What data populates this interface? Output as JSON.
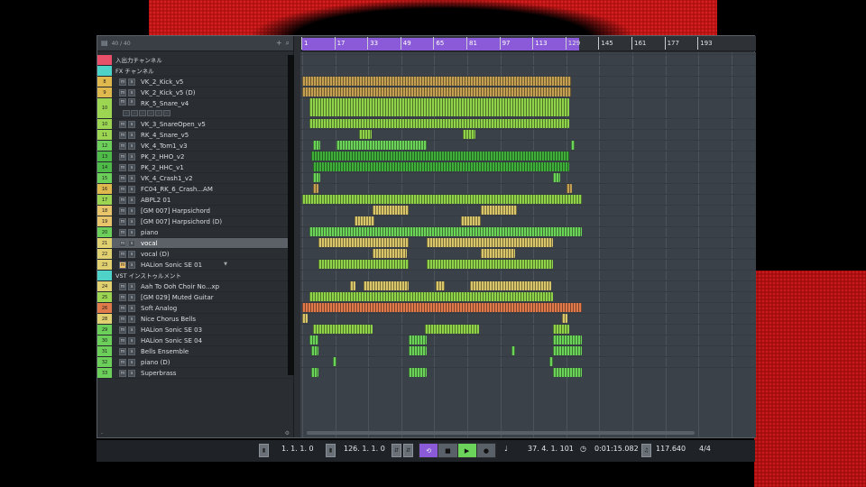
{
  "panel": {
    "count": "40 / 40",
    "add_icon": "plus-icon",
    "search_icon": "search-icon",
    "footer_left": "-",
    "footer_right": "gear-icon"
  },
  "ruler": {
    "ticks": [
      "1",
      "17",
      "33",
      "49",
      "65",
      "81",
      "97",
      "113",
      "129",
      "145",
      "161",
      "177",
      "193"
    ]
  },
  "tracks": [
    {
      "num": "",
      "name": "入出力チャンネル",
      "color": "#e8506a",
      "folder": true
    },
    {
      "num": "",
      "name": "FX チャンネル",
      "color": "#4fd3c8",
      "folder": true
    },
    {
      "num": "8",
      "name": "VK_2_Kick_v5",
      "color": "#e0b94e"
    },
    {
      "num": "9",
      "name": "VK_2_Kick_v5 (D)",
      "color": "#e0b94e"
    },
    {
      "num": "10",
      "name": "RK_5_Snare_v4",
      "color": "#9bd552"
    },
    {
      "num": "10",
      "name": "VK_3_SnareOpen_v5",
      "color": "#9bd552"
    },
    {
      "num": "11",
      "name": "RK_4_Snare_v5",
      "color": "#9bd552"
    },
    {
      "num": "12",
      "name": "VK_4_Tom1_v3",
      "color": "#6bcf5a"
    },
    {
      "num": "13",
      "name": "PK_2_HHO_v2",
      "color": "#4eba48"
    },
    {
      "num": "14",
      "name": "PK_2_HHC_v1",
      "color": "#4eba48"
    },
    {
      "num": "15",
      "name": "VK_4_Crash1_v2",
      "color": "#6bcf5a"
    },
    {
      "num": "16",
      "name": "FC04_RK_6_Crash...AM",
      "color": "#e0b94e"
    },
    {
      "num": "17",
      "name": "ABPL2 01",
      "color": "#9bd552"
    },
    {
      "num": "18",
      "name": "[GM 007] Harpsichord",
      "color": "#e8c56a"
    },
    {
      "num": "19",
      "name": "[GM 007] Harpsichord (D)",
      "color": "#e8c56a"
    },
    {
      "num": "20",
      "name": "piano",
      "color": "#6bcf5a"
    },
    {
      "num": "21",
      "name": "vocal",
      "color": "#e0d070"
    },
    {
      "num": "22",
      "name": "vocal (D)",
      "color": "#e0d070"
    },
    {
      "num": "23",
      "name": "HALion Sonic SE 01",
      "color": "#e0d070"
    },
    {
      "num": "",
      "name": "VST インストゥルメント",
      "color": "#4fd3c8",
      "folder": true
    },
    {
      "num": "24",
      "name": "Aah To Ooh Choir No...xp",
      "color": "#e0d070"
    },
    {
      "num": "25",
      "name": "[GM 029] Muted Guitar",
      "color": "#9bd552"
    },
    {
      "num": "26",
      "name": "Soft Analog",
      "color": "#e07a4a"
    },
    {
      "num": "28",
      "name": "Nice Chorus Bells",
      "color": "#e0d070"
    },
    {
      "num": "29",
      "name": "HALion Sonic SE 03",
      "color": "#6bcf5a"
    },
    {
      "num": "30",
      "name": "HALion Sonic SE 04",
      "color": "#6bcf5a"
    },
    {
      "num": "31",
      "name": "Bells Ensemble",
      "color": "#6bcf5a"
    },
    {
      "num": "32",
      "name": "piano (D)",
      "color": "#6bcf5a"
    },
    {
      "num": "33",
      "name": "Superbrass",
      "color": "#6bcf5a"
    }
  ],
  "transport": {
    "left_locator": "1. 1. 1.   0",
    "right_locator": "126. 1. 1.   0",
    "position": "37.   4.   1. 101",
    "time": "0:01:15.082",
    "tempo": "117.640",
    "signature": "4/4"
  }
}
